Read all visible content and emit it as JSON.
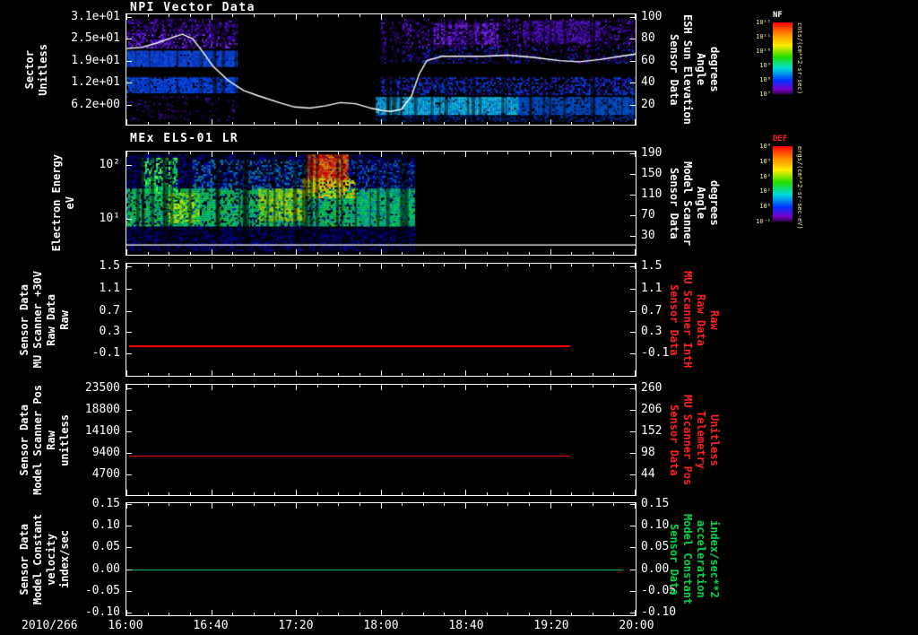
{
  "window": {
    "background": "#000000"
  },
  "x_axis": {
    "date": "2010/266",
    "ticks": [
      "16:00",
      "16:40",
      "17:20",
      "18:00",
      "18:40",
      "19:20",
      "20:00"
    ]
  },
  "panels": [
    {
      "key": "npi",
      "title": "NPI Vector Data",
      "left_group": [
        "Sector",
        "Unitless"
      ],
      "left_ticks": [
        {
          "label": "3.1e+01",
          "frac": 0.02
        },
        {
          "label": "2.5e+01",
          "frac": 0.22
        },
        {
          "label": "1.9e+01",
          "frac": 0.42
        },
        {
          "label": "1.2e+01",
          "frac": 0.62
        },
        {
          "label": "6.2e+00",
          "frac": 0.82
        }
      ],
      "right_ticks": [
        {
          "label": "100",
          "frac": 0.02
        },
        {
          "label": "80",
          "frac": 0.22
        },
        {
          "label": "60",
          "frac": 0.42
        },
        {
          "label": "40",
          "frac": 0.62
        },
        {
          "label": "20",
          "frac": 0.82
        }
      ],
      "right_group": [
        "Sensor Data",
        "ESH Sun Elevation",
        "Angle",
        "degrees"
      ],
      "right_color": "#ffffff"
    },
    {
      "key": "els",
      "title": "MEx ELS-01 LR",
      "left_group": [
        "Electron Energy",
        "eV"
      ],
      "left_ticks": [
        {
          "label": "10²",
          "frac": 0.13
        },
        {
          "label": "10¹",
          "frac": 0.65
        }
      ],
      "right_ticks": [
        {
          "label": "190",
          "frac": 0.02
        },
        {
          "label": "150",
          "frac": 0.22
        },
        {
          "label": "110",
          "frac": 0.42
        },
        {
          "label": "70",
          "frac": 0.62
        },
        {
          "label": "30",
          "frac": 0.82
        }
      ],
      "right_group": [
        "Sensor Data",
        "Model Scanner",
        "Angle",
        "degrees"
      ],
      "right_color": "#ffffff"
    },
    {
      "key": "mu-scanner-30v",
      "title": "",
      "left_group": [
        "Sensor Data",
        "MU Scanner +30V",
        "Raw Data",
        "Raw"
      ],
      "left_ticks": [
        {
          "label": "1.5",
          "frac": 0.02
        },
        {
          "label": "1.1",
          "frac": 0.22
        },
        {
          "label": "0.7",
          "frac": 0.42
        },
        {
          "label": "0.3",
          "frac": 0.61
        },
        {
          "label": "-0.1",
          "frac": 0.8
        }
      ],
      "right_ticks": [
        {
          "label": "1.5",
          "frac": 0.02
        },
        {
          "label": "1.1",
          "frac": 0.22
        },
        {
          "label": "0.7",
          "frac": 0.42
        },
        {
          "label": "0.3",
          "frac": 0.61
        },
        {
          "label": "-0.1",
          "frac": 0.8
        }
      ],
      "right_group": [
        "Sensor Data",
        "MU Scanner IntH",
        "Raw Data",
        "Raw"
      ],
      "right_color": "#ff2020"
    },
    {
      "key": "model-scanner-pos",
      "title": "",
      "left_group": [
        "Sensor Data",
        "Model Scanner Pos",
        "Raw",
        "unitless"
      ],
      "left_ticks": [
        {
          "label": "23500",
          "frac": 0.03
        },
        {
          "label": "18800",
          "frac": 0.23
        },
        {
          "label": "14100",
          "frac": 0.42
        },
        {
          "label": "9400",
          "frac": 0.62
        },
        {
          "label": "4700",
          "frac": 0.81
        }
      ],
      "right_ticks": [
        {
          "label": "260",
          "frac": 0.03
        },
        {
          "label": "206",
          "frac": 0.23
        },
        {
          "label": "152",
          "frac": 0.42
        },
        {
          "label": "98",
          "frac": 0.62
        },
        {
          "label": "44",
          "frac": 0.81
        }
      ],
      "right_group": [
        "Sensor Data",
        "MU Scanner Pos",
        "Telemetry",
        "Unitless"
      ],
      "right_color": "#ff2020"
    },
    {
      "key": "model-constant-velocity",
      "title": "",
      "left_group": [
        "Sensor Data",
        "Model Constant",
        "velocity",
        "index/sec"
      ],
      "left_ticks": [
        {
          "label": "0.15",
          "frac": 0.01
        },
        {
          "label": "0.10",
          "frac": 0.196
        },
        {
          "label": "0.05",
          "frac": 0.392
        },
        {
          "label": "0.00",
          "frac": 0.588
        },
        {
          "label": "-0.05",
          "frac": 0.784
        },
        {
          "label": "-0.10",
          "frac": 0.975
        }
      ],
      "right_ticks": [
        {
          "label": "0.15",
          "frac": 0.01
        },
        {
          "label": "0.10",
          "frac": 0.196
        },
        {
          "label": "0.05",
          "frac": 0.392
        },
        {
          "label": "0.00",
          "frac": 0.588
        },
        {
          "label": "-0.05",
          "frac": 0.784
        },
        {
          "label": "-0.10",
          "frac": 0.975
        }
      ],
      "right_group": [
        "Sensor Data",
        "Model Constant",
        "acceleration",
        "index/sec**2"
      ],
      "right_color": "#00d848"
    }
  ],
  "colorbars": [
    {
      "title": "NF",
      "title_color": "#ffffff",
      "ticks": [
        "10¹²",
        "10¹¹",
        "10¹⁰",
        "10⁹",
        "10⁸",
        "10⁷"
      ],
      "unit": "cnts/(cm**2-sr-sec)"
    },
    {
      "title": "DEF",
      "title_color": "#ff2020",
      "ticks": [
        "10⁴",
        "10³",
        "10²",
        "10¹",
        "10⁰",
        "10⁻¹"
      ],
      "unit": "ergs/(cm**2-sr-sec-eV)"
    }
  ],
  "chart_data": [
    {
      "type": "heatmap",
      "title": "NPI Vector Data",
      "ylabel": "Sector (Unitless)",
      "ytick_labels": [
        "3.1e+01",
        "2.5e+01",
        "1.9e+01",
        "1.2e+01",
        "6.2e+00"
      ],
      "x_range": [
        "2010/266 16:00",
        "2010/266 20:00"
      ],
      "data_intervals": [
        [
          "16:00",
          "16:53"
        ],
        [
          "17:58",
          "20:00"
        ]
      ],
      "colorbar": "NF",
      "unit": "cnts/(cm**2-sr-sec)",
      "regions": [
        {
          "x0": 0.0,
          "x1": 0.215,
          "y0": 0.04,
          "y1": 0.18,
          "colors": [
            "#4400aa",
            "#5c14cc",
            "#33007f",
            "#220066"
          ],
          "density": 0.5
        },
        {
          "x0": 0.0,
          "x1": 0.215,
          "y0": 0.18,
          "y1": 0.31,
          "colors": [
            "#4400aa",
            "#5c14cc",
            "#2a0099",
            "#7733dd"
          ],
          "density": 0.55
        },
        {
          "x0": 0.0,
          "x1": 0.215,
          "y0": 0.33,
          "y1": 0.47,
          "colors": [
            "#0033cc",
            "#004ce6",
            "#0f5cf0",
            "#2244dd"
          ],
          "density": 0.95
        },
        {
          "x0": 0.0,
          "x1": 0.215,
          "y0": 0.57,
          "y1": 0.71,
          "colors": [
            "#0030bb",
            "#0042d8",
            "#0a50e8"
          ],
          "density": 0.9
        },
        {
          "x0": 0.0,
          "x1": 0.215,
          "y0": 0.74,
          "y1": 0.96,
          "colors": [
            "#33007f",
            "#4400aa"
          ],
          "density": 0.1
        },
        {
          "x0": 0.5,
          "x1": 1.0,
          "y0": 0.04,
          "y1": 0.3,
          "colors": [
            "#4400aa",
            "#5c14cc",
            "#33007f",
            "#220066"
          ],
          "density": 0.35
        },
        {
          "x0": 0.6,
          "x1": 0.73,
          "y0": 0.08,
          "y1": 0.27,
          "colors": [
            "#5c14cc",
            "#7733dd",
            "#4400aa"
          ],
          "density": 0.55
        },
        {
          "x0": 0.78,
          "x1": 0.93,
          "y0": 0.06,
          "y1": 0.25,
          "colors": [
            "#5c14cc",
            "#4400aa",
            "#33118f"
          ],
          "density": 0.6
        },
        {
          "x0": 0.5,
          "x1": 1.0,
          "y0": 0.3,
          "y1": 0.44,
          "colors": [
            "#2a0099",
            "#0030bb",
            "#33007f"
          ],
          "density": 0.3
        },
        {
          "x0": 0.5,
          "x1": 1.0,
          "y0": 0.57,
          "y1": 0.73,
          "colors": [
            "#0030bb",
            "#33007f",
            "#0042d8"
          ],
          "density": 0.5
        },
        {
          "x0": 0.49,
          "x1": 0.77,
          "y0": 0.75,
          "y1": 0.91,
          "colors": [
            "#00aaff",
            "#33ccff",
            "#0088ee",
            "#00ddee"
          ],
          "density": 0.95
        },
        {
          "x0": 0.77,
          "x1": 1.0,
          "y0": 0.75,
          "y1": 0.91,
          "colors": [
            "#0055dd",
            "#0044cc",
            "#0066e0"
          ],
          "density": 0.85
        },
        {
          "x0": 0.49,
          "x1": 1.0,
          "y0": 0.91,
          "y1": 0.97,
          "colors": [
            "#0033aa",
            "#002288"
          ],
          "density": 0.4
        }
      ],
      "stripes": [
        {
          "x0": 0.0,
          "x1": 0.215,
          "count": 10
        },
        {
          "x0": 0.5,
          "x1": 1.0,
          "count": 28
        }
      ],
      "overlay_line": {
        "name": "ESH Sun Elevation Angle (degrees)",
        "color": "#ffffff",
        "axis_range": [
          0,
          100
        ],
        "v0": 100,
        "f0": 0.02,
        "df": 0.01,
        "x_frac": [
          0,
          0.03,
          0.06,
          0.09,
          0.11,
          0.13,
          0.15,
          0.17,
          0.2,
          0.23,
          0.26,
          0.3,
          0.33,
          0.36,
          0.39,
          0.42,
          0.45,
          0.48,
          0.5,
          0.52,
          0.54,
          0.56,
          0.575,
          0.59,
          0.62,
          0.66,
          0.7,
          0.75,
          0.8,
          0.85,
          0.89,
          0.93,
          0.97,
          1.0
        ],
        "values": [
          71,
          72,
          76,
          81,
          84,
          80,
          68,
          55,
          42,
          33,
          28,
          22,
          18,
          17,
          19,
          22,
          21,
          17,
          15,
          14,
          16,
          28,
          48,
          60,
          64,
          64,
          64,
          65,
          63,
          60,
          59,
          61,
          64,
          66
        ]
      }
    },
    {
      "type": "heatmap",
      "title": "MEx ELS-01 LR",
      "ylabel": "Electron Energy (eV)",
      "yscale": "log",
      "ytick_labels": [
        "10²",
        "10¹"
      ],
      "x_range": [
        "2010/266 16:00",
        "2010/266 20:00"
      ],
      "data_intervals": [
        [
          "16:00",
          "18:15"
        ]
      ],
      "colorbar": "DEF",
      "unit": "ergs/(cm**2-sr-sec-eV)",
      "regions": [
        {
          "x0": 0.0,
          "x1": 0.565,
          "y0": 0.03,
          "y1": 0.96,
          "colors": [
            "#000033",
            "#000066",
            "#000099",
            "#0000cc"
          ],
          "density": 0.5
        },
        {
          "x0": 0.0,
          "x1": 0.565,
          "y0": 0.36,
          "y1": 0.72,
          "colors": [
            "#00cc66",
            "#00e07a",
            "#33cc33",
            "#00aaaa",
            "#00bb44"
          ],
          "density": 0.75
        },
        {
          "x0": 0.08,
          "x1": 0.14,
          "y0": 0.4,
          "y1": 0.68,
          "colors": [
            "#99dd00",
            "#ccee00",
            "#66cc00"
          ],
          "density": 0.5
        },
        {
          "x0": 0.26,
          "x1": 0.35,
          "y0": 0.36,
          "y1": 0.66,
          "colors": [
            "#aadd00",
            "#dddd00",
            "#88cc00"
          ],
          "density": 0.55
        },
        {
          "x0": 0.03,
          "x1": 0.1,
          "y0": 0.06,
          "y1": 0.4,
          "colors": [
            "#00dd44",
            "#66ff44",
            "#00cc88",
            "#00aa66"
          ],
          "density": 0.6
        },
        {
          "x0": 0.13,
          "x1": 0.36,
          "y0": 0.08,
          "y1": 0.36,
          "colors": [
            "#0044bb",
            "#0077cc",
            "#009999"
          ],
          "density": 0.3
        },
        {
          "x0": 0.355,
          "x1": 0.435,
          "y0": 0.03,
          "y1": 0.28,
          "colors": [
            "#ff2200",
            "#ff6600",
            "#ffaa00",
            "#ee0000"
          ],
          "density": 0.9
        },
        {
          "x0": 0.345,
          "x1": 0.45,
          "y0": 0.26,
          "y1": 0.44,
          "colors": [
            "#ff9900",
            "#dddd00",
            "#99dd00"
          ],
          "density": 0.65
        },
        {
          "x0": 0.435,
          "x1": 0.565,
          "y0": 0.08,
          "y1": 0.36,
          "colors": [
            "#0044bb",
            "#0066cc"
          ],
          "density": 0.25
        },
        {
          "x0": 0.45,
          "x1": 0.56,
          "y0": 0.36,
          "y1": 0.72,
          "colors": [
            "#00bb55",
            "#00cc77",
            "#0088bb"
          ],
          "density": 0.55
        }
      ],
      "stripes": [
        {
          "x0": 0.0,
          "x1": 0.565,
          "count": 36
        }
      ],
      "overlay_line": {
        "name": "Model Scanner Angle (degrees)",
        "color": "#ffffff",
        "constant_value": 12,
        "y_frac": 0.905,
        "x0": 0,
        "x1": 1
      }
    },
    {
      "type": "line",
      "ylabel": "Sensor Data MU Scanner +30V Raw Data (Raw)",
      "right_label": "Sensor Data MU Scanner IntH Raw Data (Raw)",
      "ytick_values": [
        1.5,
        1.1,
        0.7,
        0.3,
        -0.1
      ],
      "series": [
        {
          "name": "MU Scanner +30V Raw",
          "color": "#ff0000",
          "constant_value": 0.0,
          "y_frac": 0.73,
          "x0": 0.005,
          "x1": 0.872,
          "x_extent": [
            "16:00",
            "19:30"
          ]
        }
      ]
    },
    {
      "type": "line",
      "ylabel": "Sensor Data Model Scanner Pos Raw (unitless)",
      "right_label": "Sensor Data MU Scanner Pos Telemetry (Unitless)",
      "ytick_values": [
        23500,
        18800,
        14100,
        9400,
        4700
      ],
      "right_tick_values": [
        260,
        206,
        152,
        98,
        44
      ],
      "series": [
        {
          "name": "Model Scanner Pos Raw",
          "color": "#ff0000",
          "constant_value": 8800,
          "y_frac": 0.64,
          "x0": 0.005,
          "x1": 0.872,
          "x_extent": [
            "16:00",
            "19:30"
          ]
        }
      ]
    },
    {
      "type": "line",
      "ylabel": "Sensor Data Model Constant velocity (index/sec)",
      "right_label": "Sensor Data Model Constant acceleration (index/sec**2)",
      "ytick_values": [
        0.15,
        0.1,
        0.05,
        0.0,
        -0.05,
        -0.1
      ],
      "series": [
        {
          "name": "Model Constant velocity",
          "color": "#00c864",
          "constant_value": 0.0,
          "y_frac": 0.588,
          "x0": 0.005,
          "x1": 0.975,
          "x_extent": [
            "16:00",
            "19:55"
          ]
        }
      ]
    }
  ]
}
